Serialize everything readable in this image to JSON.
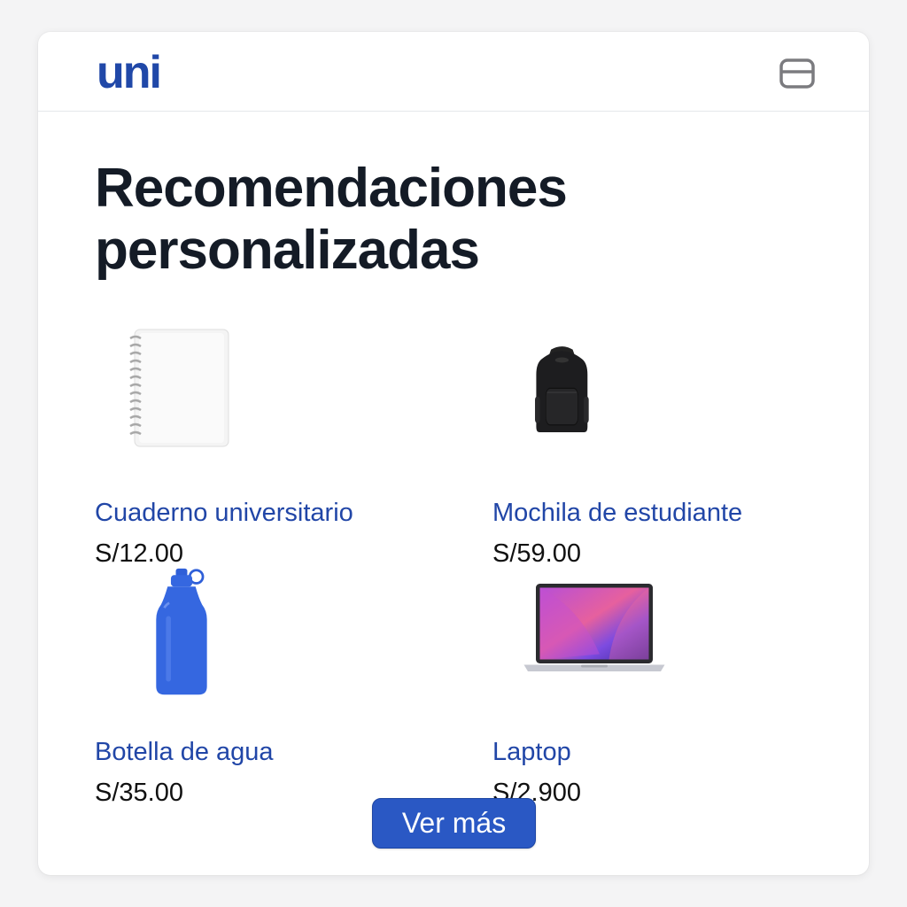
{
  "header": {
    "logo": "uni",
    "icon": "card-icon"
  },
  "page": {
    "title": "Recomendaciones personalizadas"
  },
  "products": [
    {
      "name": "Cuaderno universitario",
      "price": "S/12.00",
      "icon": "notebook-icon"
    },
    {
      "name": "Mochila de estudiante",
      "price": "S/59.00",
      "icon": "backpack-icon"
    },
    {
      "name": "Botella de agua",
      "price": "S/35.00",
      "icon": "water-bottle-icon"
    },
    {
      "name": "Laptop",
      "price": "S/2.900",
      "icon": "laptop-icon"
    }
  ],
  "actions": {
    "more_label": "Ver más"
  },
  "colors": {
    "accent": "#2a58c4",
    "link": "#2146a7",
    "title": "#141b26"
  }
}
